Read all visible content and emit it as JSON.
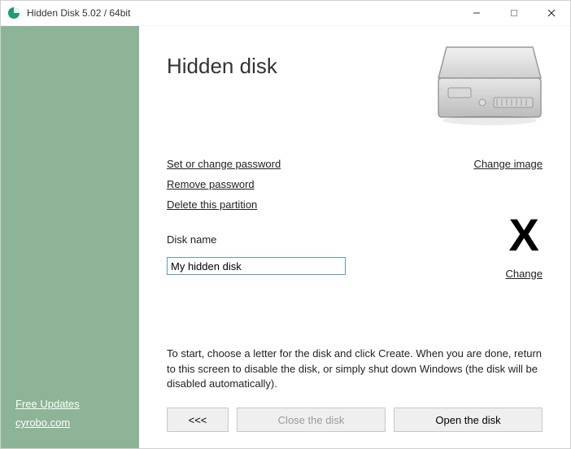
{
  "titlebar": {
    "title": "Hidden Disk 5.02 / 64bit"
  },
  "sidebar": {
    "free_updates": "Free Updates",
    "vendor": "cyrobo.com"
  },
  "main": {
    "heading": "Hidden disk",
    "links": {
      "set_password": "Set or change password",
      "remove_password": "Remove password",
      "delete_partition": "Delete this partition",
      "change_image": "Change image",
      "change_letter": "Change"
    },
    "disk_name_label": "Disk name",
    "disk_name_value": "My hidden disk",
    "drive_letter": "X",
    "instructions": "To start, choose a letter for the disk and click Create. When you are done, return to this screen to disable the disk, or simply shut down Windows (the disk will be disabled automatically).",
    "buttons": {
      "back": "<<<",
      "close": "Close the disk",
      "open": "Open the disk"
    }
  }
}
